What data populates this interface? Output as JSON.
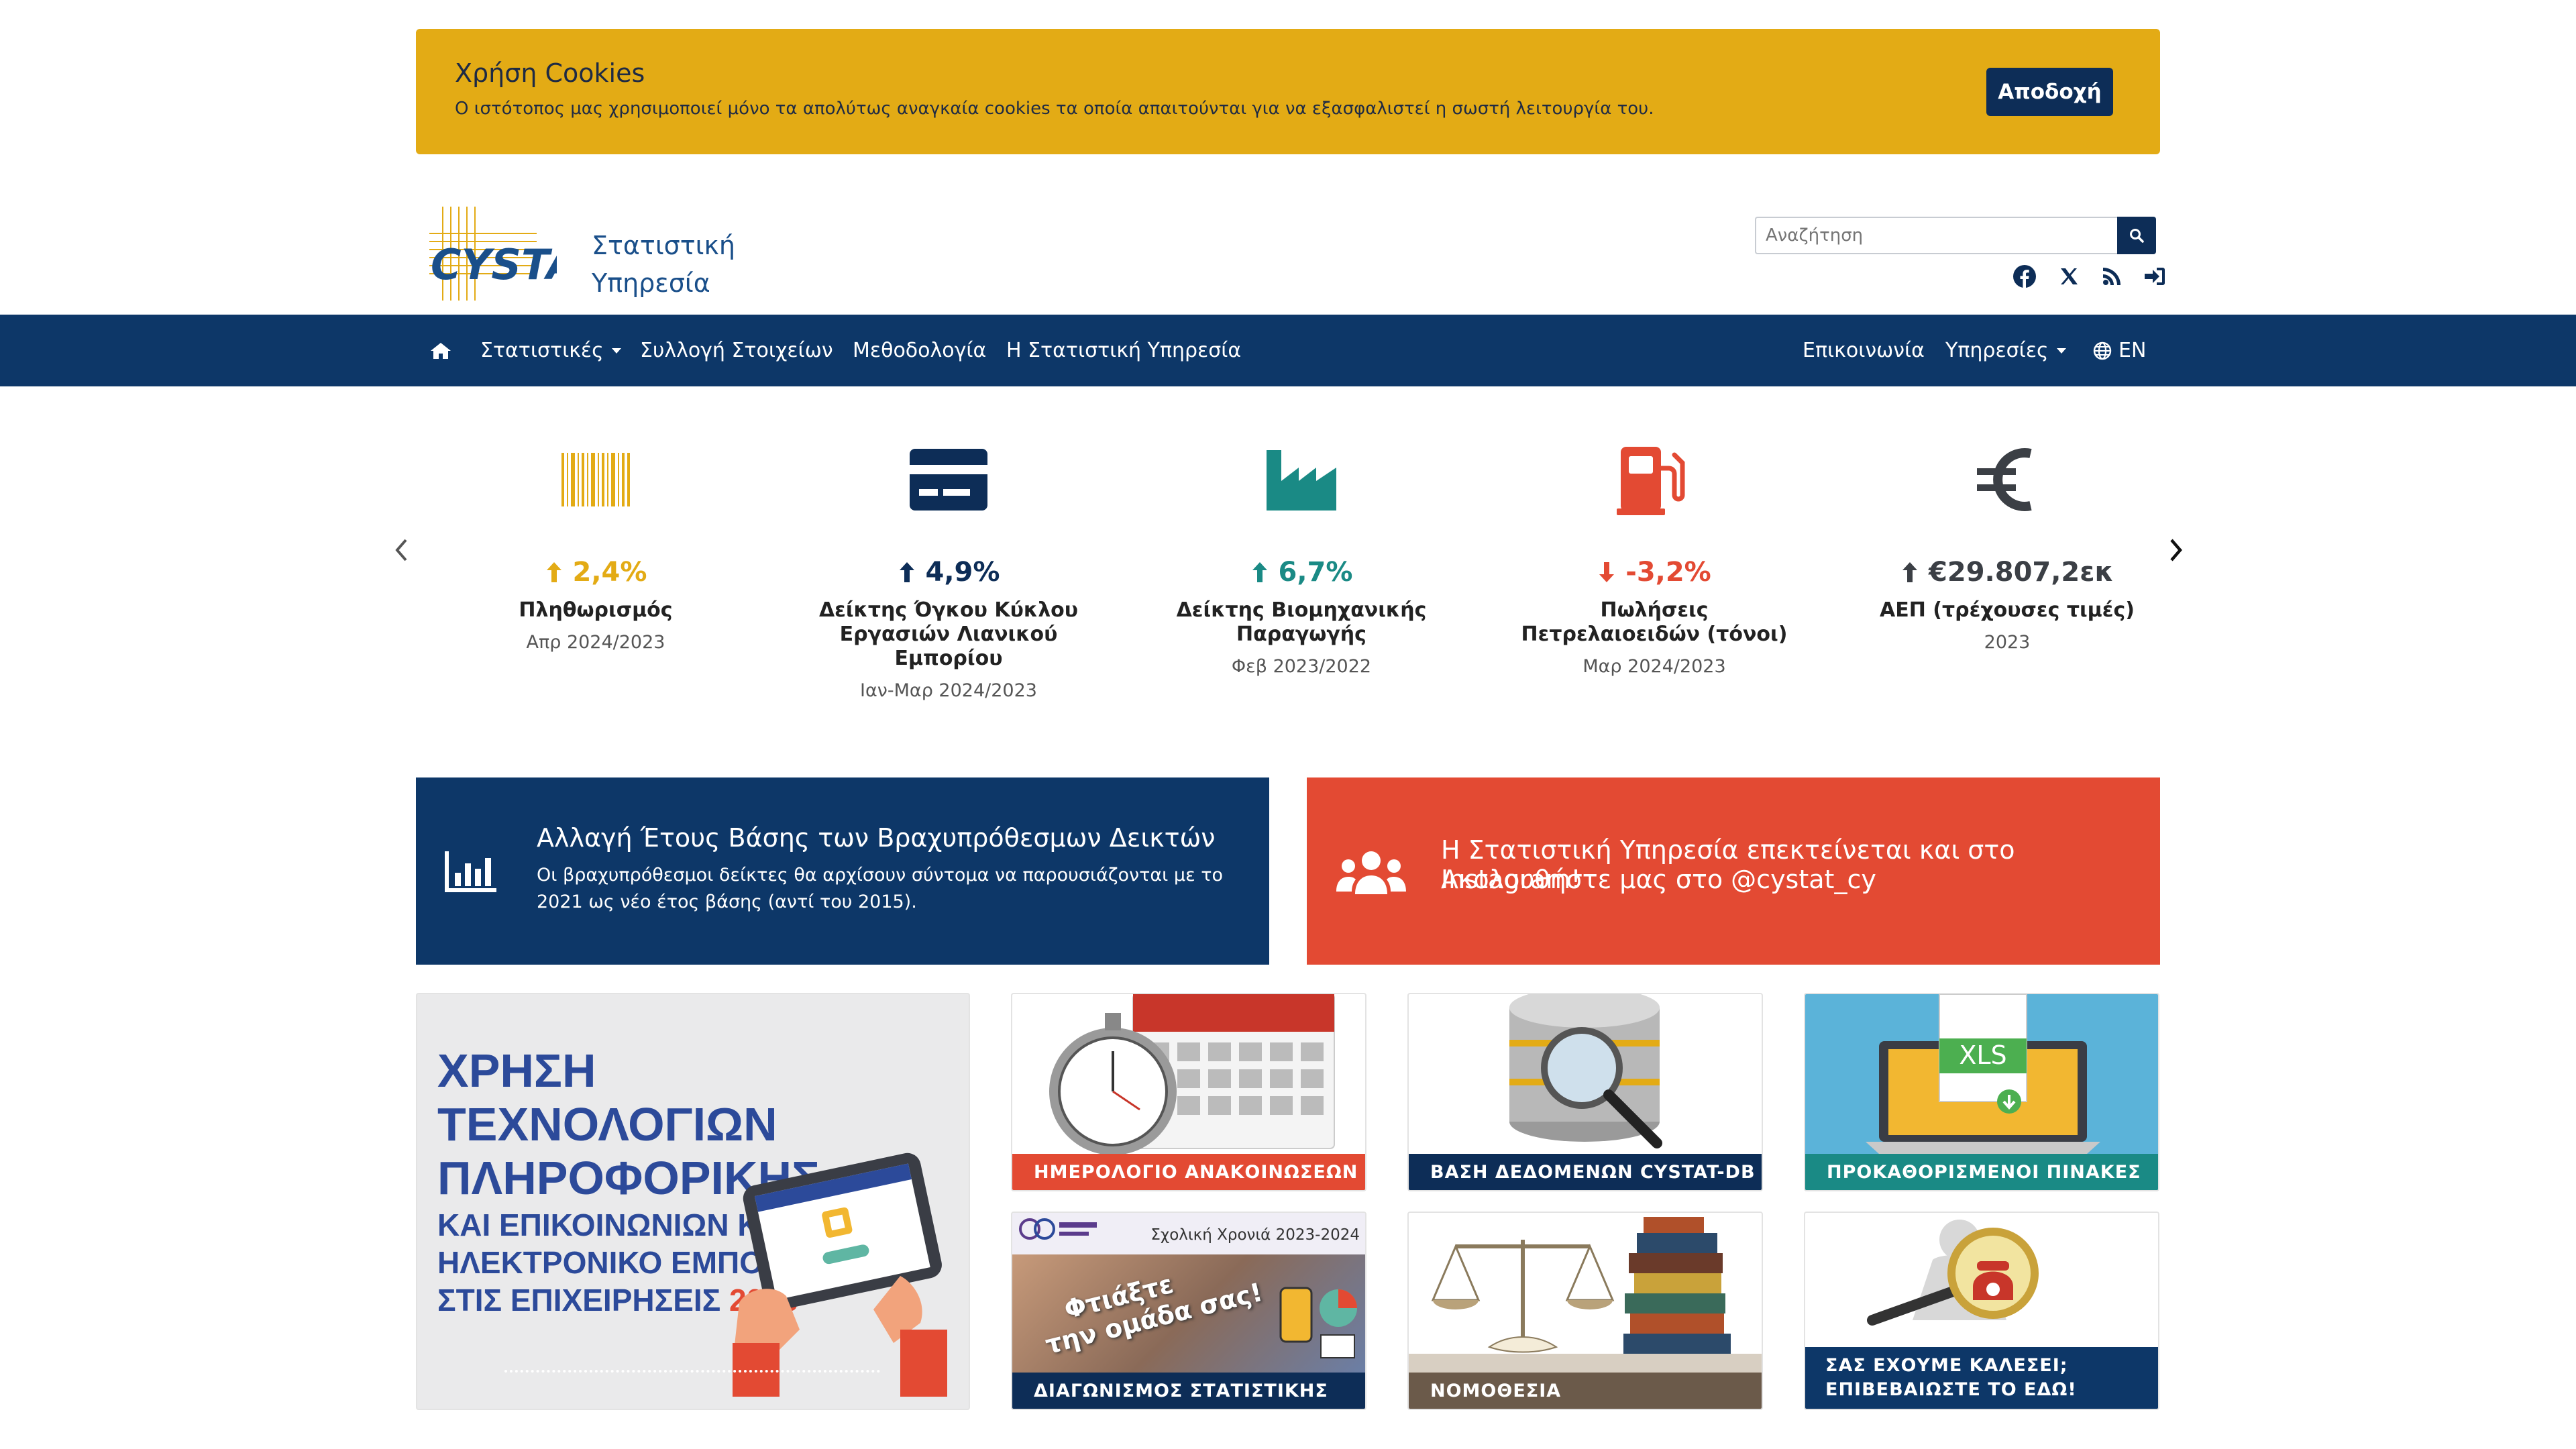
{
  "cookie": {
    "title": "Χρήση Cookies",
    "text": "Ο ιστότοπος μας χρησιμοποιεί μόνο τα απολύτως αναγκαία cookies τα οποία απαιτούνται για να εξασφαλιστεί η σωστή λειτουργία του.",
    "accept_label": "Αποδοχή"
  },
  "header": {
    "logo_text": "CYSTAT",
    "title_line1": "Στατιστική",
    "title_line2": "Υπηρεσία",
    "search_placeholder": "Αναζήτηση"
  },
  "nav": {
    "left": [
      {
        "label": "Στατιστικές",
        "dropdown": true
      },
      {
        "label": "Συλλογή Στοιχείων",
        "dropdown": false
      },
      {
        "label": "Μεθοδολογία",
        "dropdown": false
      },
      {
        "label": "Η Στατιστική Υπηρεσία",
        "dropdown": false
      }
    ],
    "right": [
      {
        "label": "Επικοινωνία",
        "dropdown": false
      },
      {
        "label": "Υπηρεσίες",
        "dropdown": true
      },
      {
        "label": "EN",
        "dropdown": false
      }
    ]
  },
  "indicators": [
    {
      "value": "2,4%",
      "direction": "up",
      "color": "#e3ab15",
      "label": "Πληθωρισμός",
      "period": "Απρ 2024/2023",
      "icon": "barcode-icon"
    },
    {
      "value": "4,9%",
      "direction": "up",
      "color": "#0d2d57",
      "label": "Δείκτης Όγκου Κύκλου Εργασιών Λιανικού Εμπορίου",
      "period": "Ιαν-Μαρ 2024/2023",
      "icon": "credit-card-icon"
    },
    {
      "value": "6,7%",
      "direction": "up",
      "color": "#1a8a85",
      "label": "Δείκτης Βιομηχανικής Παραγωγής",
      "period": "Φεβ 2023/2022",
      "icon": "factory-icon"
    },
    {
      "value": "-3,2%",
      "direction": "down",
      "color": "#e34a33",
      "label": "Πωλήσεις Πετρελαιοειδών (τόνοι)",
      "period": "Μαρ 2024/2023",
      "icon": "gas-pump-icon"
    },
    {
      "value": "€29.807,2εκ",
      "direction": "up",
      "color": "#3b3f45",
      "label": "ΑΕΠ (τρέχουσες τιμές)",
      "period": "2023",
      "icon": "euro-icon"
    }
  ],
  "promos": {
    "blue": {
      "title": "Αλλαγή Έτους Βάσης των Βραχυπρόθεσμων Δεικτών",
      "text": "Οι βραχυπρόθεσμοι δείκτες θα αρχίσουν σύντομα να παρουσιάζονται με το 2021 ως νέο έτος βάσης (αντί του 2015)."
    },
    "red": {
      "line1": "Η Στατιστική Υπηρεσία επεκτείνεται και στο Instagram!",
      "line2": "Ακολουθήστε μας στο @cystat_cy"
    }
  },
  "feature": {
    "line1": "ΧΡΗΣΗ",
    "line2": "ΤΕΧΝΟΛΟΓΙΩΝ",
    "line3": "ΠΛΗΡΟΦΟΡΙΚΗΣ",
    "line4": "ΚΑΙ ΕΠΙΚΟΙΝΩΝΙΩΝ ΚΑΙ",
    "line5": "ΗΛΕΚΤΡΟΝΙΚΟ ΕΜΠΟΡΙΟ",
    "line6": "ΣΤΙΣ ΕΠΙΧΕΙΡΗΣΕΙΣ",
    "year": "2023"
  },
  "tiles": [
    {
      "caption": "ΗΜΕΡΟΛΟΓΙΟ ΑΝΑΚΟΙΝΩΣΕΩΝ",
      "color": "#e34a33"
    },
    {
      "caption": "ΒΑΣΗ ΔΕΔΟΜΕΝΩΝ CYSTAT-DB",
      "color": "#0d2d57"
    },
    {
      "caption": "ΠΡΟΚΑΘΟΡΙΣΜΕΝΟΙ ΠΙΝΑΚΕΣ",
      "color": "#1a8a85"
    },
    {
      "caption": "ΔΙΑΓΩΝΙΣΜΟΣ ΣΤΑΤΙΣΤΙΚΗΣ",
      "color": "#0d2d57",
      "badge": "Σχολική Χρονιά 2023-2024",
      "slogan1": "Φτιάξτε",
      "slogan2": "την ομάδα σας!"
    },
    {
      "caption": "ΝΟΜΟΘΕΣΙΑ",
      "color": "#6b5a4a"
    },
    {
      "caption1": "ΣΑΣ ΕΧΟΥΜΕ ΚΑΛΕΣΕΙ;",
      "caption2": "ΕΠΙΒΕΒΑΙΩΣΤΕ ΤΟ ΕΔΩ!",
      "color": "#0d3768"
    }
  ],
  "tile_xls_label": "XLS"
}
